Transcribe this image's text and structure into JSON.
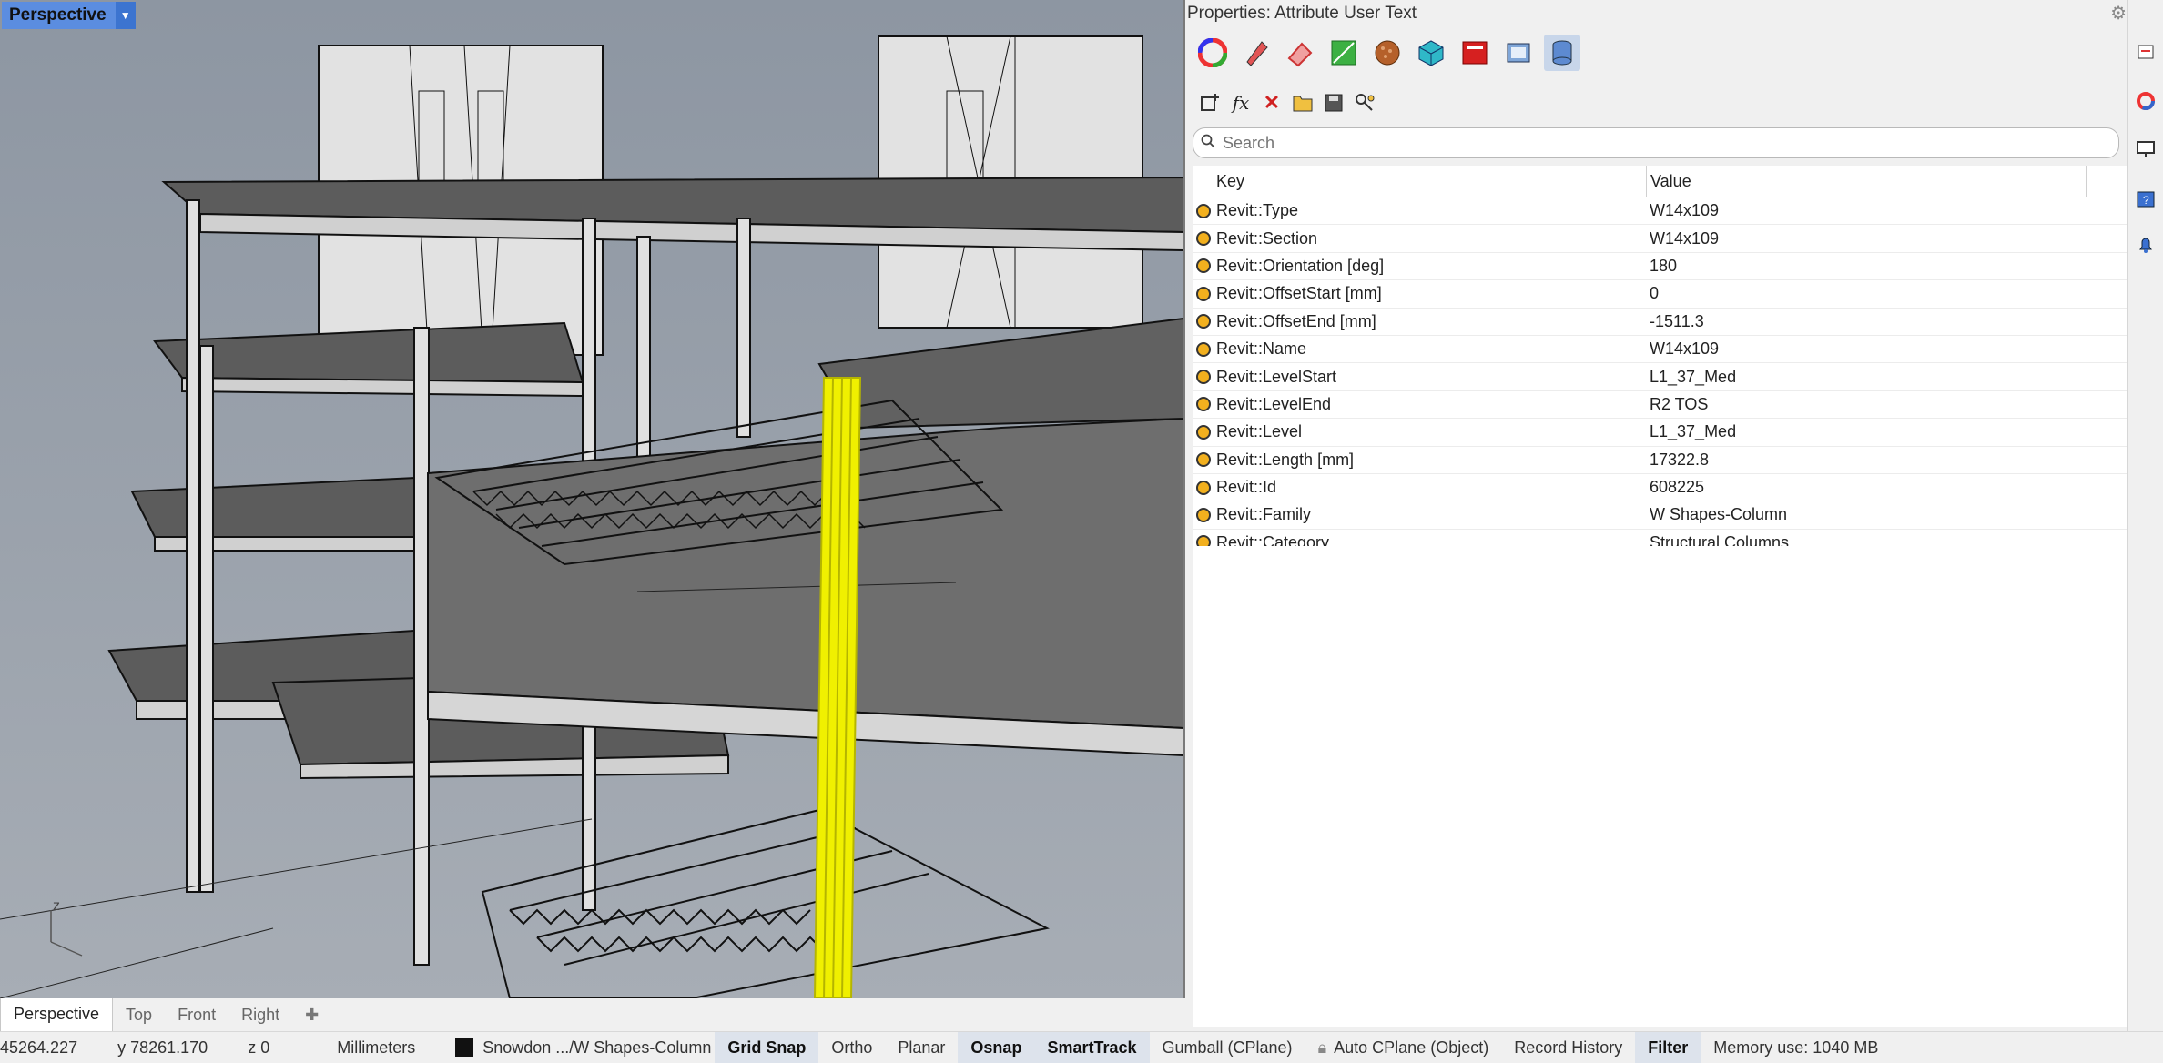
{
  "viewport": {
    "title": "Perspective",
    "axis_label": "z"
  },
  "viewport_tabs": [
    "Perspective",
    "Top",
    "Front",
    "Right"
  ],
  "panel": {
    "title": "Properties: Attribute User Text",
    "search_placeholder": "Search",
    "columns": {
      "key": "Key",
      "value": "Value"
    },
    "rows": [
      {
        "key": "Revit::Type",
        "value": "W14x109"
      },
      {
        "key": "Revit::Section",
        "value": "W14x109"
      },
      {
        "key": "Revit::Orientation [deg]",
        "value": "180"
      },
      {
        "key": "Revit::OffsetStart [mm]",
        "value": "0"
      },
      {
        "key": "Revit::OffsetEnd [mm]",
        "value": "-1511.3"
      },
      {
        "key": "Revit::Name",
        "value": "W14x109"
      },
      {
        "key": "Revit::LevelStart",
        "value": "L1_37_Med"
      },
      {
        "key": "Revit::LevelEnd",
        "value": "R2 TOS"
      },
      {
        "key": "Revit::Level",
        "value": "L1_37_Med"
      },
      {
        "key": "Revit::Length [mm]",
        "value": "17322.8"
      },
      {
        "key": "Revit::Id",
        "value": "608225"
      },
      {
        "key": "Revit::Family",
        "value": "W Shapes-Column"
      },
      {
        "key": "Revit::Category",
        "value": "Structural Columns"
      }
    ],
    "toolbar_icons": [
      "color-wheel-icon",
      "pen-icon",
      "eraser-icon",
      "green-square-icon",
      "sphere-icon",
      "cube-icon",
      "red-box-icon",
      "window-icon",
      "database-icon"
    ],
    "action_icons": [
      "add-key-icon",
      "fx-icon",
      "delete-icon",
      "open-folder-icon",
      "save-icon",
      "link-icon"
    ]
  },
  "status": {
    "x": "45264.227",
    "y": "y 78261.170",
    "z": "z 0",
    "units": "Millimeters",
    "layer": "Snowdon .../W Shapes-Column",
    "grid_snap": "Grid Snap",
    "ortho": "Ortho",
    "planar": "Planar",
    "osnap": "Osnap",
    "smarttrack": "SmartTrack",
    "gumball": "Gumball (CPlane)",
    "autocplane": "Auto CPlane (Object)",
    "record_history": "Record History",
    "filter": "Filter",
    "memory": "Memory use: 1040 MB"
  },
  "colors": {
    "highlight": "#f0f000",
    "title_bg": "#5b8de0",
    "dot": "#f2b01e"
  }
}
